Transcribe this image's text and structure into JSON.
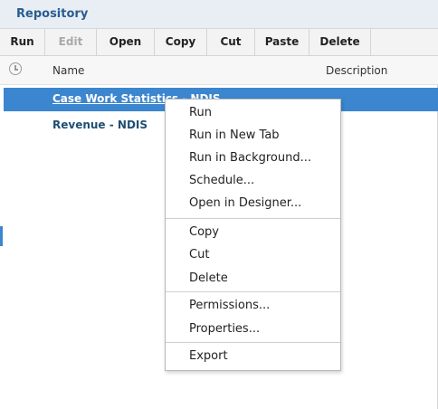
{
  "panel": {
    "title": "Repository"
  },
  "toolbar": {
    "buttons": [
      {
        "label": "Run",
        "enabled": true
      },
      {
        "label": "Edit",
        "enabled": false
      },
      {
        "label": "Open",
        "enabled": true
      },
      {
        "label": "Copy",
        "enabled": true
      },
      {
        "label": "Cut",
        "enabled": true
      },
      {
        "label": "Paste",
        "enabled": true
      },
      {
        "label": "Delete",
        "enabled": true
      }
    ]
  },
  "table": {
    "headers": {
      "name": "Name",
      "description": "Description"
    },
    "rows": [
      {
        "name": "Case Work Statistics - NDIS",
        "selected": true
      },
      {
        "name": "Revenue - NDIS",
        "selected": false
      }
    ]
  },
  "context_menu": {
    "groups": [
      [
        "Run",
        "Run in New Tab",
        "Run in Background...",
        "Schedule...",
        "Open in Designer..."
      ],
      [
        "Copy",
        "Cut",
        "Delete"
      ],
      [
        "Permissions...",
        "Properties..."
      ],
      [
        "Export"
      ]
    ]
  },
  "colors": {
    "selection": "#3b86cf",
    "title_text": "#2a5d8f",
    "disabled_text": "#a9a9a9"
  }
}
